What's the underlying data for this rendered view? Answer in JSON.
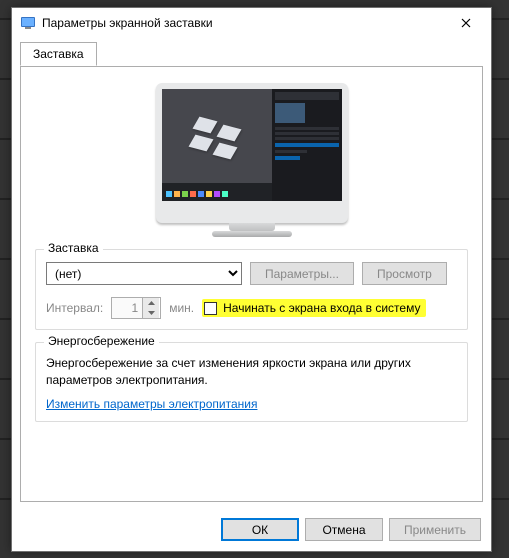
{
  "titlebar": {
    "title": "Параметры экранной заставки"
  },
  "tabs": {
    "screensaver": "Заставка"
  },
  "screensaver": {
    "group_label": "Заставка",
    "selected": "(нет)",
    "options": [
      "(нет)"
    ],
    "settings_btn": "Параметры...",
    "preview_btn": "Просмотр",
    "interval_label": "Интервал:",
    "interval_value": "1",
    "interval_unit": "мин.",
    "resume_checkbox_label": "Начинать с экрана входа в систему"
  },
  "power": {
    "group_label": "Энергосбережение",
    "text": "Энергосбережение за счет изменения яркости экрана или других параметров электропитания.",
    "link": "Изменить параметры электропитания"
  },
  "footer": {
    "ok": "ОК",
    "cancel": "Отмена",
    "apply": "Применить"
  }
}
